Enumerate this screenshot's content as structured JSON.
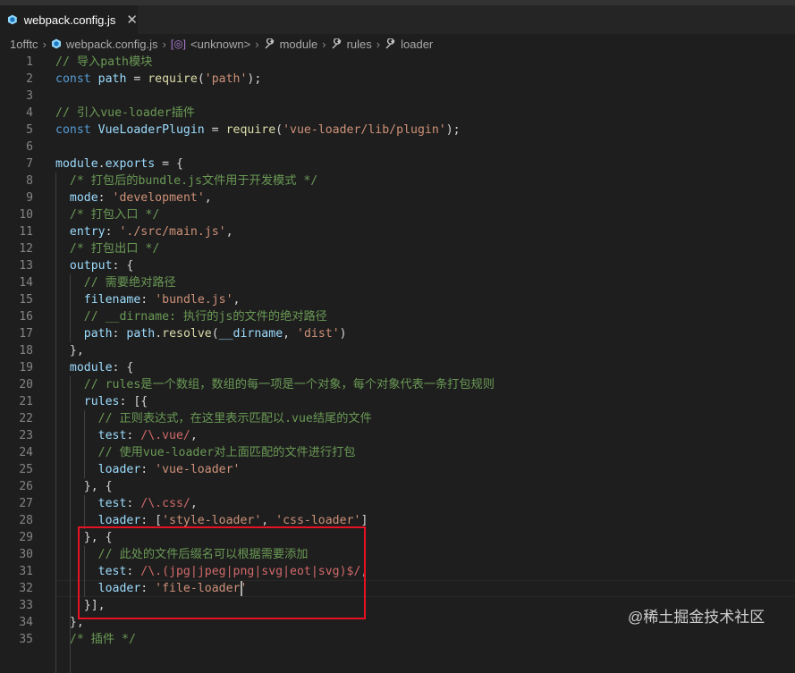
{
  "tab": {
    "label": "webpack.config.js",
    "close": "✕",
    "icon": "js-file-icon"
  },
  "breadcrumb": {
    "items": [
      "1offtc",
      "webpack.config.js",
      "<unknown>",
      "module",
      "rules",
      "loader"
    ],
    "separator": "›"
  },
  "watermark": "@稀土掘金技术社区",
  "colors": {
    "background": "#1e1e1e",
    "comment": "#6a9955",
    "keyword": "#569cd6",
    "variable": "#9cdcfe",
    "function": "#dcdcaa",
    "string": "#ce9178",
    "regex": "#d16969",
    "highlight_box": "#e81123"
  },
  "lines": [
    {
      "n": "1",
      "tokens": [
        [
          "cmt",
          "// 导入path模块"
        ]
      ]
    },
    {
      "n": "2",
      "tokens": [
        [
          "kw",
          "const "
        ],
        [
          "var",
          "path"
        ],
        [
          "pl",
          " = "
        ],
        [
          "fn",
          "require"
        ],
        [
          "pl",
          "("
        ],
        [
          "str",
          "'path'"
        ],
        [
          "pl",
          ");"
        ]
      ]
    },
    {
      "n": "3",
      "tokens": []
    },
    {
      "n": "4",
      "tokens": [
        [
          "cmt",
          "// 引入vue-loader插件"
        ]
      ]
    },
    {
      "n": "5",
      "tokens": [
        [
          "kw",
          "const "
        ],
        [
          "var",
          "VueLoaderPlugin"
        ],
        [
          "pl",
          " = "
        ],
        [
          "fn",
          "require"
        ],
        [
          "pl",
          "("
        ],
        [
          "str",
          "'vue-loader/lib/plugin'"
        ],
        [
          "pl",
          ");"
        ]
      ]
    },
    {
      "n": "6",
      "tokens": []
    },
    {
      "n": "7",
      "tokens": [
        [
          "var",
          "module"
        ],
        [
          "pl",
          "."
        ],
        [
          "var",
          "exports"
        ],
        [
          "pl",
          " = {"
        ]
      ]
    },
    {
      "n": "8",
      "tokens": [
        [
          "pl",
          "  "
        ],
        [
          "cmt",
          "/* 打包后的bundle.js文件用于开发模式 */"
        ]
      ]
    },
    {
      "n": "9",
      "tokens": [
        [
          "pl",
          "  "
        ],
        [
          "var",
          "mode"
        ],
        [
          "pl",
          ": "
        ],
        [
          "str",
          "'development'"
        ],
        [
          "pl",
          ","
        ]
      ]
    },
    {
      "n": "10",
      "tokens": [
        [
          "pl",
          "  "
        ],
        [
          "cmt",
          "/* 打包入口 */"
        ]
      ]
    },
    {
      "n": "11",
      "tokens": [
        [
          "pl",
          "  "
        ],
        [
          "var",
          "entry"
        ],
        [
          "pl",
          ": "
        ],
        [
          "str",
          "'./src/main.js'"
        ],
        [
          "pl",
          ","
        ]
      ]
    },
    {
      "n": "12",
      "tokens": [
        [
          "pl",
          "  "
        ],
        [
          "cmt",
          "/* 打包出口 */"
        ]
      ]
    },
    {
      "n": "13",
      "tokens": [
        [
          "pl",
          "  "
        ],
        [
          "var",
          "output"
        ],
        [
          "pl",
          ": {"
        ]
      ]
    },
    {
      "n": "14",
      "tokens": [
        [
          "pl",
          "    "
        ],
        [
          "cmt",
          "// 需要绝对路径"
        ]
      ]
    },
    {
      "n": "15",
      "tokens": [
        [
          "pl",
          "    "
        ],
        [
          "var",
          "filename"
        ],
        [
          "pl",
          ": "
        ],
        [
          "str",
          "'bundle.js'"
        ],
        [
          "pl",
          ","
        ]
      ]
    },
    {
      "n": "16",
      "tokens": [
        [
          "pl",
          "    "
        ],
        [
          "cmt",
          "// __dirname: 执行的js的文件的绝对路径"
        ]
      ]
    },
    {
      "n": "17",
      "tokens": [
        [
          "pl",
          "    "
        ],
        [
          "var",
          "path"
        ],
        [
          "pl",
          ": "
        ],
        [
          "var",
          "path"
        ],
        [
          "pl",
          "."
        ],
        [
          "fn",
          "resolve"
        ],
        [
          "pl",
          "("
        ],
        [
          "var",
          "__dirname"
        ],
        [
          "pl",
          ", "
        ],
        [
          "str",
          "'dist'"
        ],
        [
          "pl",
          ")"
        ]
      ]
    },
    {
      "n": "18",
      "tokens": [
        [
          "pl",
          "  },"
        ]
      ]
    },
    {
      "n": "19",
      "tokens": [
        [
          "pl",
          "  "
        ],
        [
          "var",
          "module"
        ],
        [
          "pl",
          ": {"
        ]
      ]
    },
    {
      "n": "20",
      "tokens": [
        [
          "pl",
          "    "
        ],
        [
          "cmt",
          "// rules是一个数组，数组的每一项是一个对象，每个对象代表一条打包规则"
        ]
      ]
    },
    {
      "n": "21",
      "tokens": [
        [
          "pl",
          "    "
        ],
        [
          "var",
          "rules"
        ],
        [
          "pl",
          ": [{"
        ]
      ]
    },
    {
      "n": "22",
      "tokens": [
        [
          "pl",
          "      "
        ],
        [
          "cmt",
          "// 正则表达式，在这里表示匹配以.vue结尾的文件"
        ]
      ]
    },
    {
      "n": "23",
      "tokens": [
        [
          "pl",
          "      "
        ],
        [
          "var",
          "test"
        ],
        [
          "pl",
          ": "
        ],
        [
          "rx",
          "/\\.vue/"
        ],
        [
          "pl",
          ","
        ]
      ]
    },
    {
      "n": "24",
      "tokens": [
        [
          "pl",
          "      "
        ],
        [
          "cmt",
          "// 使用vue-loader对上面匹配的文件进行打包"
        ]
      ]
    },
    {
      "n": "25",
      "tokens": [
        [
          "pl",
          "      "
        ],
        [
          "var",
          "loader"
        ],
        [
          "pl",
          ": "
        ],
        [
          "str",
          "'vue-loader'"
        ]
      ]
    },
    {
      "n": "26",
      "tokens": [
        [
          "pl",
          "    }, {"
        ]
      ]
    },
    {
      "n": "27",
      "tokens": [
        [
          "pl",
          "      "
        ],
        [
          "var",
          "test"
        ],
        [
          "pl",
          ": "
        ],
        [
          "rx",
          "/\\.css/"
        ],
        [
          "pl",
          ","
        ]
      ]
    },
    {
      "n": "28",
      "tokens": [
        [
          "pl",
          "      "
        ],
        [
          "var",
          "loader"
        ],
        [
          "pl",
          ": ["
        ],
        [
          "str",
          "'style-loader'"
        ],
        [
          "pl",
          ", "
        ],
        [
          "str",
          "'css-loader'"
        ],
        [
          "pl",
          "]"
        ]
      ]
    },
    {
      "n": "29",
      "tokens": [
        [
          "pl",
          "    }, {"
        ]
      ]
    },
    {
      "n": "30",
      "tokens": [
        [
          "pl",
          "      "
        ],
        [
          "cmt",
          "// 此处的文件后缀名可以根据需要添加"
        ]
      ]
    },
    {
      "n": "31",
      "tokens": [
        [
          "pl",
          "      "
        ],
        [
          "var",
          "test"
        ],
        [
          "pl",
          ": "
        ],
        [
          "rx",
          "/\\.(jpg|jpeg|png|svg|eot|svg)$/"
        ],
        [
          "pl",
          ","
        ]
      ]
    },
    {
      "n": "32",
      "tokens": [
        [
          "pl",
          "      "
        ],
        [
          "var",
          "loader"
        ],
        [
          "pl",
          ": "
        ],
        [
          "str",
          "'file-loader'"
        ]
      ]
    },
    {
      "n": "33",
      "tokens": [
        [
          "pl",
          "    }],"
        ]
      ]
    },
    {
      "n": "34",
      "tokens": [
        [
          "pl",
          "  },"
        ]
      ]
    },
    {
      "n": "35",
      "tokens": [
        [
          "pl",
          "  "
        ],
        [
          "cmt",
          "/* 插件 */"
        ]
      ]
    }
  ]
}
